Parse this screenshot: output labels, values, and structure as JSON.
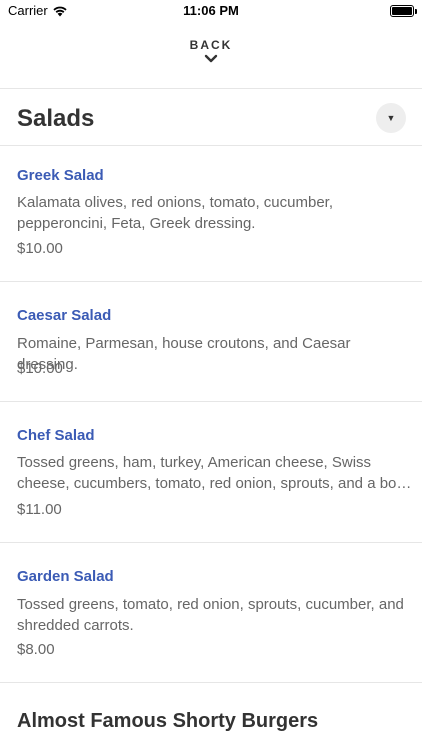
{
  "status_bar": {
    "carrier": "Carrier",
    "time": "11:06 PM"
  },
  "nav": {
    "back_label": "BACK"
  },
  "section": {
    "title": "Salads"
  },
  "items": [
    {
      "name": "Greek Salad",
      "description": "Kalamata olives, red onions, tomato, cucumber, pepperoncini, Feta, Greek dressing.",
      "price": "$10.00"
    },
    {
      "name": "Caesar Salad",
      "description": "Romaine, Parmesan, house croutons, and Caesar dressing.",
      "price": "$10.00"
    },
    {
      "name": "Chef Salad",
      "description": "Tossed greens, ham, turkey, American cheese, Swiss cheese, cucumbers, tomato, red onion, sprouts, and a bo…",
      "price": "$11.00"
    },
    {
      "name": "Garden Salad",
      "description": "Tossed greens, tomato, red onion, sprouts, cucumber, and shredded carrots.",
      "price": "$8.00"
    }
  ],
  "next_section": {
    "title": "Almost Famous Shorty Burgers"
  },
  "colors": {
    "item_name": "#3b5bb5",
    "text_primary": "#333333",
    "text_secondary": "#666666",
    "divider": "#e6e6e6"
  }
}
